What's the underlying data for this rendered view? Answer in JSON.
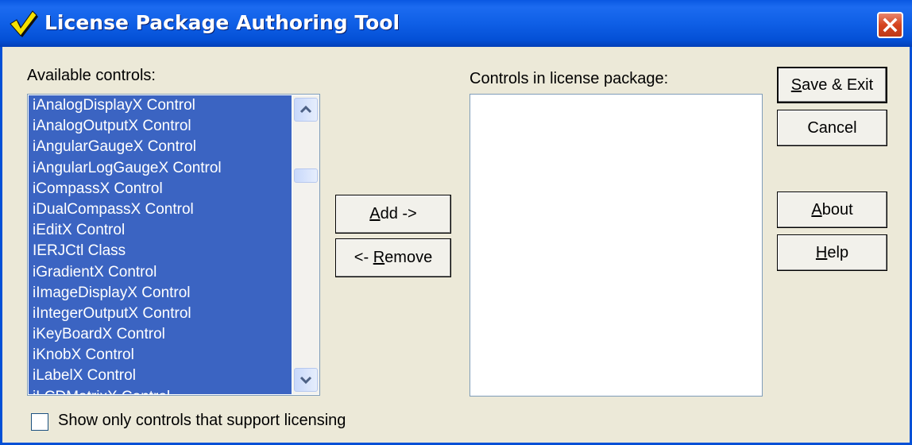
{
  "window": {
    "title": "License Package Authoring Tool",
    "title_icon": "check-icon",
    "close_icon": "close-icon"
  },
  "available": {
    "label": "Available controls:",
    "items": [
      "iAnalogDisplayX Control",
      "iAnalogOutputX Control",
      "iAngularGaugeX Control",
      "iAngularLogGaugeX Control",
      "iCompassX Control",
      "iDualCompassX Control",
      "iEditX Control",
      "IERJCtl Class",
      "iGradientX Control",
      "iImageDisplayX Control",
      "iIntegerOutputX Control",
      "iKeyBoardX Control",
      "iKnobX Control",
      "iLabelX Control",
      "iLCDMatrixX Control"
    ]
  },
  "package": {
    "label": "Controls in license package:"
  },
  "buttons": {
    "add": "Add ->",
    "remove": "<- Remove",
    "save": "Save & Exit",
    "cancel": "Cancel",
    "about": "About",
    "help": "Help"
  },
  "checkbox": {
    "label": "Show only controls that support licensing",
    "checked": false
  },
  "colors": {
    "titlebar": "#0450d6",
    "selection": "#3b64c2",
    "dialog_bg": "#ece9d8"
  }
}
